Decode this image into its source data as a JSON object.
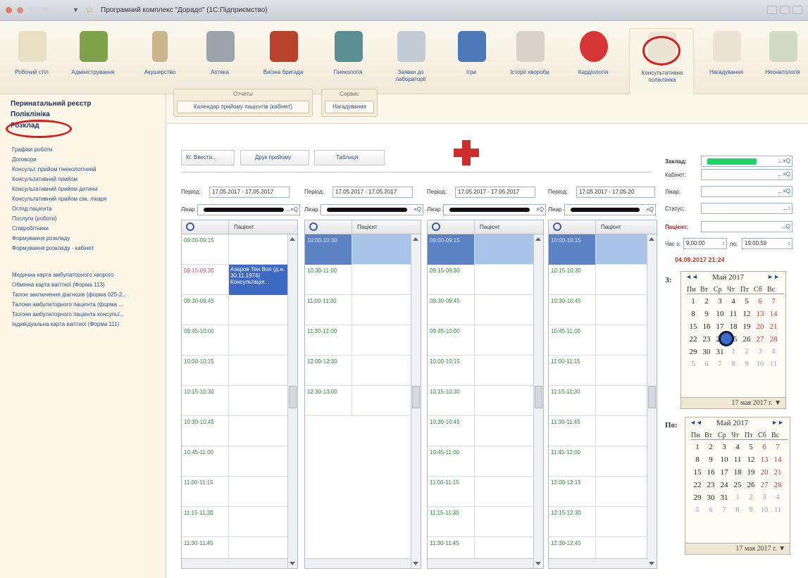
{
  "window": {
    "title": "Програмний комплекс \"Дорадо\" (1С:Підприємство)"
  },
  "toolbar": {
    "items": [
      {
        "label": "Робочий стіл"
      },
      {
        "label": "Адміністрування"
      },
      {
        "label": "Акушерство"
      },
      {
        "label": "Аптека"
      },
      {
        "label": "Виїзна бригада"
      },
      {
        "label": "Гінекологія"
      },
      {
        "label": "Заявки до лабораторії"
      },
      {
        "label": "Ігри"
      },
      {
        "label": "Історії хвороби"
      },
      {
        "label": "Кардіологія"
      },
      {
        "label": "Консультативна поліклініка"
      },
      {
        "label": "Нагадування"
      },
      {
        "label": "Неонатологія"
      }
    ]
  },
  "sidebar": {
    "headers": [
      "Перинатальний реєстр",
      "Поліклініка",
      "Розклад"
    ],
    "items": [
      "Графіки роботи",
      "Договори",
      "Консульт. прийом гінекологічний",
      "Консультативний прийом",
      "Консультативний прийом дитини",
      "Консультативний прийом сім. лікаря",
      "Огляд пацієнта",
      "Послуги (роботи)",
      "Співробітники",
      "Формування розкладу",
      "Формування розкладу - кабінет",
      "Медична карта амбулаторного хворого",
      "Обмінна карта вагітної (Форма 113)",
      "Талон заключення діагнозів (форма 025-2...",
      "Талони амбулаторного пацієнта (форма ...",
      "Талони амбулаторного пацієнта консульт...",
      "Індивідуальна карта вагітної (Форма 111)"
    ]
  },
  "subbar": {
    "groups": [
      {
        "caption": "Отчеты",
        "button": "Календар прийому пацієнтів (кабінет)"
      },
      {
        "caption": "Сервис",
        "button": "Нагадування"
      }
    ]
  },
  "actions": {
    "btn1": "Кг. Ввести...",
    "btn2": "Друк прийому",
    "btn3": "Таблиця"
  },
  "columns": [
    {
      "period_label": "Період:",
      "period": "17.05.2017 - 17.05.2017",
      "doctor_label": "Лікар 1:",
      "patient_header": "Пацієнт",
      "slots": [
        "09:00-09:15",
        "09:15-09:30",
        "09:30-09:45",
        "09:45-10:00",
        "10:00-10:15",
        "10:15-10:30",
        "10:30-10:45",
        "10:45-11:00",
        "11:00-11:15",
        "11:15-11:30",
        "11:30-11:45"
      ],
      "appointment": "Азаров Тен Вол (д.н. 30.11.1974) Консультація..."
    },
    {
      "period_label": "Період:",
      "period": "17.05.2017 - 17.05.2017",
      "doctor_label": "Лікар 2:",
      "patient_header": "Пацієнт",
      "slots": [
        "10:00-10:30",
        "10:30-11:00",
        "11:00-11:30",
        "11:30-12:00",
        "12:00-12:30",
        "12:30-13:00"
      ]
    },
    {
      "period_label": "Період:",
      "period": "17.05.2017 - 17.05.2017",
      "doctor_label": "Лікар 3:",
      "patient_header": "Пацієнт",
      "slots": [
        "09:00-09:15",
        "09:15-09:30",
        "09:30-09:45",
        "09:45-10:00",
        "10:00-10:15",
        "10:15-10:30",
        "10:30-10:45",
        "10:45-11:00",
        "11:00-11:15",
        "11:15-11:30",
        "11:30-11:45"
      ]
    },
    {
      "period_label": "Період:",
      "period": "17.05.2017 - 17.05.20",
      "doctor_label": "Лікар 4:",
      "patient_header": "Пацієнт",
      "slots": [
        "10:00-10:15",
        "10:15-10:30",
        "10:30-10:45",
        "10:45-11:00",
        "11:00-11:15",
        "11:15-11:30",
        "11:30-11:45",
        "11:45-12:00",
        "12:00-12:15",
        "12:15-12:30",
        "12:30-12:45"
      ]
    }
  ],
  "right_panel": {
    "zaklad": "Заклад:",
    "kabinet": "Кабінет:",
    "likar": "Лікар:",
    "status": "Статус:",
    "patient": "Пацієнт:",
    "time_from_label": "Час з:",
    "time_from": "9:00:00",
    "time_to_label": "по:",
    "time_to": "19:00:59",
    "datetime": "04.09.2017 21:24",
    "from_label": "З:",
    "to_label": "По:"
  },
  "calendar": {
    "month": "Май 2017",
    "weekdays": [
      "Пн",
      "Вт",
      "Ср",
      "Чт",
      "Пт",
      "Сб",
      "Вс"
    ],
    "footer": "17 мая 2017 г.",
    "prev": "◄◄",
    "next": "►►"
  }
}
